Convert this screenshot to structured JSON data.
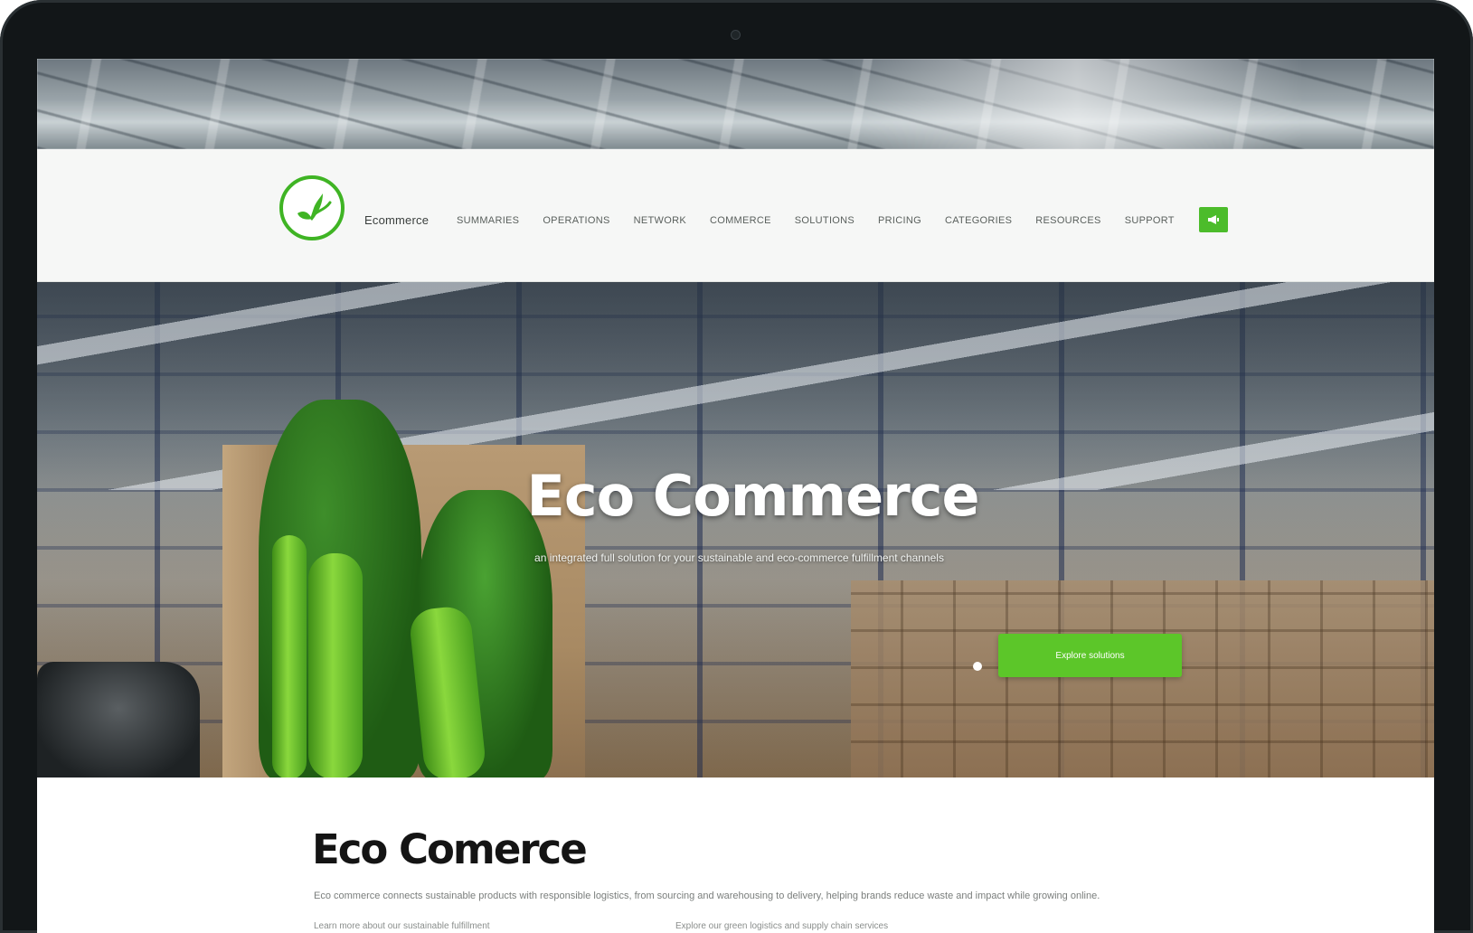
{
  "header": {
    "brand": "Ecommerce",
    "nav_items": [
      "SUMMARIES",
      "OPERATIONS",
      "NETWORK",
      "COMMERCE",
      "SOLUTIONS",
      "PRICING",
      "CATEGORIES",
      "RESOURCES",
      "SUPPORT"
    ]
  },
  "hero": {
    "title": "Eco Commerce",
    "subtitle": "an integrated full solution for your sustainable and eco-commerce fulfillment channels",
    "cta_label": "Explore solutions"
  },
  "content": {
    "title": "Eco Comerce",
    "body": "Eco commerce connects sustainable products with responsible logistics, from sourcing and warehousing to delivery, helping brands reduce waste and impact while growing online.",
    "col_left": "Learn more about our sustainable fulfillment",
    "col_right": "Explore our green logistics and supply chain services"
  },
  "colors": {
    "accent": "#4cbc2b",
    "logo_ring": "#3fb424",
    "header_bg": "#f6f7f6"
  },
  "icons": {
    "logo": "leaf-check-icon",
    "nav_cta": "megaphone-icon"
  }
}
